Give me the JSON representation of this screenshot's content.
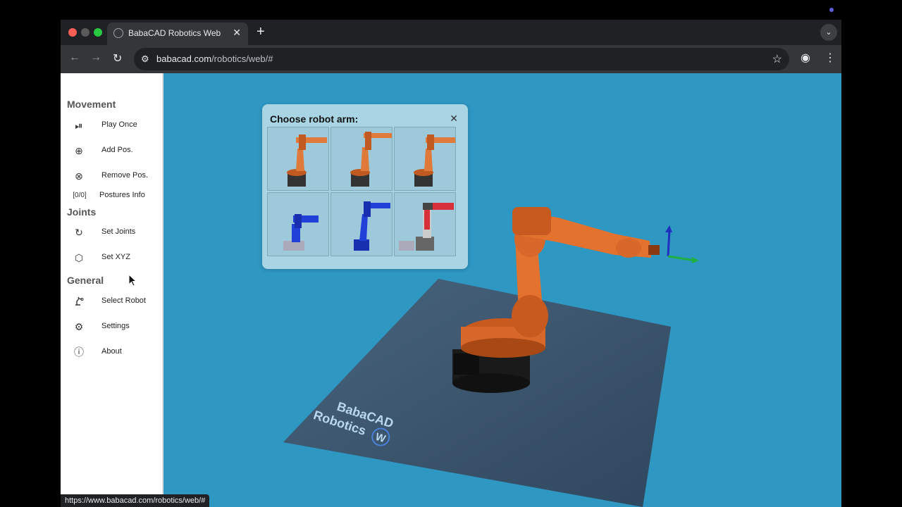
{
  "browser": {
    "tab_title": "BabaCAD Robotics Web",
    "url_host": "babacad.com",
    "url_path": "/robotics/web/#",
    "status_url": "https://www.babacad.com/robotics/web/#"
  },
  "sidebar": {
    "movement_title": "Movement",
    "movement_items": [
      {
        "label": "Play Once",
        "icon": "play-pause-icon"
      },
      {
        "label": "Add Pos.",
        "icon": "add-circle-icon"
      },
      {
        "label": "Remove Pos.",
        "icon": "remove-circle-icon"
      },
      {
        "label": "Postures Info",
        "counter": "[0/0]"
      }
    ],
    "joints_title": "Joints",
    "joints_items": [
      {
        "label": "Set Joints",
        "icon": "refresh-icon"
      },
      {
        "label": "Set XYZ",
        "icon": "cube-icon"
      }
    ],
    "general_title": "General",
    "general_items": [
      {
        "label": "Select Robot",
        "icon": "robot-arm-icon"
      },
      {
        "label": "Settings",
        "icon": "gear-icon"
      },
      {
        "label": "About",
        "icon": "info-icon"
      }
    ]
  },
  "robot_chooser": {
    "title": "Choose robot arm:",
    "options": [
      {
        "color": "#e07a3a"
      },
      {
        "color": "#e07a3a"
      },
      {
        "color": "#e07a3a"
      },
      {
        "color": "#2040d8"
      },
      {
        "color": "#2040d8"
      },
      {
        "color": "#d8303a"
      }
    ]
  },
  "scene": {
    "background_color": "#2e97c2",
    "robot_color": "#e2722e",
    "floor_logo_line1": "BabaCAD",
    "floor_logo_line2": "Robotics",
    "floor_logo_badge": "W"
  }
}
